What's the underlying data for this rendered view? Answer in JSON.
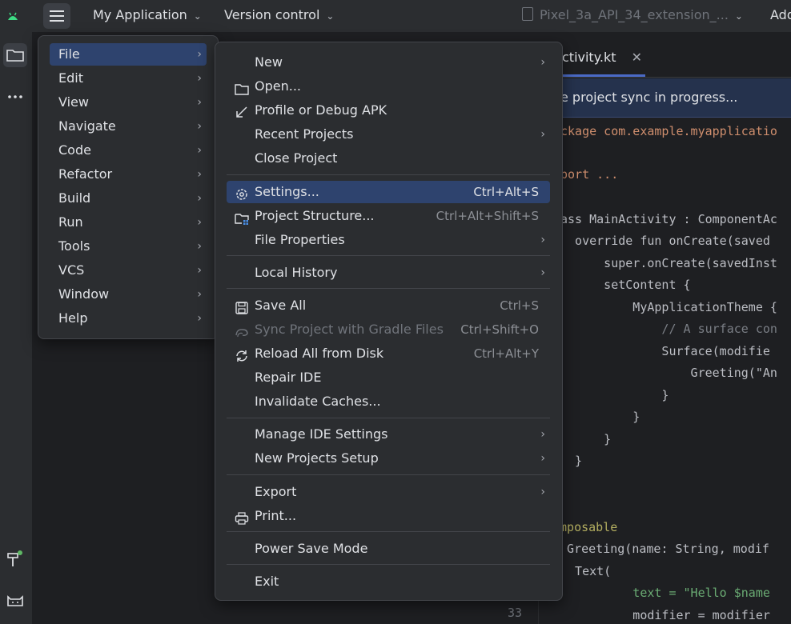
{
  "toolbar": {
    "project": "My Application",
    "vcs": "Version control",
    "device": "Pixel_3a_API_34_extension_...",
    "add": "Add"
  },
  "main_menu": {
    "items": [
      {
        "label": "File"
      },
      {
        "label": "Edit"
      },
      {
        "label": "View"
      },
      {
        "label": "Navigate"
      },
      {
        "label": "Code"
      },
      {
        "label": "Refactor"
      },
      {
        "label": "Build"
      },
      {
        "label": "Run"
      },
      {
        "label": "Tools"
      },
      {
        "label": "VCS"
      },
      {
        "label": "Window"
      },
      {
        "label": "Help"
      }
    ]
  },
  "file_menu": {
    "new": "New",
    "open": "Open...",
    "profile": "Profile or Debug APK",
    "recent": "Recent Projects",
    "close": "Close Project",
    "settings": "Settings...",
    "settings_sc": "Ctrl+Alt+S",
    "structure": "Project Structure...",
    "structure_sc": "Ctrl+Alt+Shift+S",
    "file_props": "File Properties",
    "local_history": "Local History",
    "save_all": "Save All",
    "save_all_sc": "Ctrl+S",
    "sync": "Sync Project with Gradle Files",
    "sync_sc": "Ctrl+Shift+O",
    "reload": "Reload All from Disk",
    "reload_sc": "Ctrl+Alt+Y",
    "repair": "Repair IDE",
    "invalidate": "Invalidate Caches...",
    "manage": "Manage IDE Settings",
    "new_setup": "New Projects Setup",
    "export": "Export",
    "print": "Print...",
    "power": "Power Save Mode",
    "exit": "Exit"
  },
  "editor": {
    "tab": "ctivity.kt",
    "banner": "e project sync in progress...",
    "line_number": "33",
    "code": [
      {
        "text": "ckage com.example.myapplicatio",
        "color": "#cf8e6d"
      },
      {
        "text": "port ...",
        "color": "#cf8e6d"
      },
      {
        "text": "ass MainActivity : ComponentAc",
        "color": "#bcbec4"
      },
      {
        "text": "  override fun onCreate(saved",
        "color": "#bcbec4"
      },
      {
        "text": "      super.onCreate(savedInst",
        "color": "#bcbec4"
      },
      {
        "text": "      setContent {",
        "color": "#bcbec4"
      },
      {
        "text": "          MyApplicationTheme {",
        "color": "#bcbec4"
      },
      {
        "text": "              // A surface con",
        "color": "#7a7e85"
      },
      {
        "text": "              Surface(modifie",
        "color": "#bcbec4"
      },
      {
        "text": "                  Greeting(\"An",
        "color": "#bcbec4"
      },
      {
        "text": "              }",
        "color": "#bcbec4"
      },
      {
        "text": "          }",
        "color": "#bcbec4"
      },
      {
        "text": "      }",
        "color": "#bcbec4"
      },
      {
        "text": "  }",
        "color": "#bcbec4"
      },
      {
        "text": "omposable",
        "color": "#b3ae60"
      },
      {
        "text": "n Greeting(name: String, modif",
        "color": "#bcbec4"
      },
      {
        "text": "  Text(",
        "color": "#bcbec4"
      },
      {
        "text": "          text = \"Hello $name",
        "color": "#6aab73"
      },
      {
        "text": "          modifier = modifier",
        "color": "#bcbec4"
      }
    ]
  }
}
